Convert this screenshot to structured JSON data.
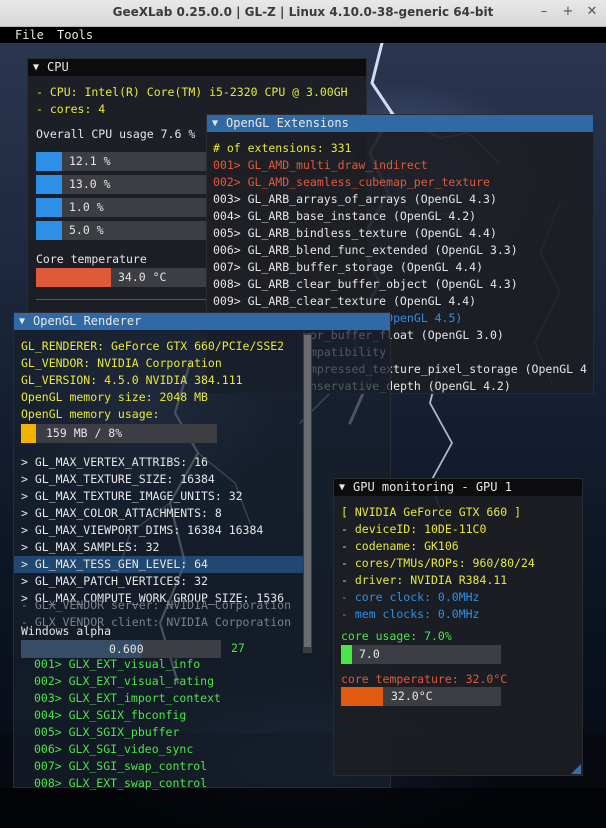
{
  "window": {
    "title": "GeeXLab 0.25.0.0 | GL-Z | Linux 4.10.0-38-generic 64-bit",
    "minimize": "–",
    "maximize": "+",
    "close": "✕"
  },
  "menu": [
    "File",
    "Tools"
  ],
  "cpu": {
    "title": "CPU",
    "name_line": "- CPU: Intel(R) Core(TM) i5-2320 CPU @ 3.00GH",
    "cores_line": "- cores: 4",
    "usage_label": "Overall CPU usage 7.6 %",
    "core_bars": [
      {
        "label": "12.1 %",
        "value": 12.1
      },
      {
        "label": "13.0 %",
        "value": 13.0
      },
      {
        "label": "1.0 %",
        "value": 1.0
      },
      {
        "label": "5.0 %",
        "value": 5.0
      }
    ],
    "temp_label": "Core temperature",
    "temp_value": "34.0 °C",
    "temp_fraction": 0.34,
    "colors": {
      "bar_fill": "#2e8fe6",
      "temp_fill": "#e05a3a"
    }
  },
  "extensions": {
    "title": "OpenGL Extensions",
    "count_line": "# of extensions: 331",
    "items": [
      {
        "text": "001> GL_AMD_multi_draw_indirect",
        "style": "r"
      },
      {
        "text": "002> GL_AMD_seamless_cubemap_per_texture",
        "style": "r"
      },
      {
        "text": "003> GL_ARB_arrays_of_arrays (OpenGL 4.3)",
        "style": "w"
      },
      {
        "text": "004> GL_ARB_base_instance (OpenGL 4.2)",
        "style": "w"
      },
      {
        "text": "005> GL_ARB_bindless_texture (OpenGL 4.4)",
        "style": "w"
      },
      {
        "text": "006> GL_ARB_blend_func_extended (OpenGL 3.3)",
        "style": "w"
      },
      {
        "text": "007> GL_ARB_buffer_storage (OpenGL 4.4)",
        "style": "w"
      },
      {
        "text": "008> GL_ARB_clear_buffer_object (OpenGL 4.3)",
        "style": "w"
      },
      {
        "text": "009> GL_ARB_clear_texture (OpenGL 4.4)",
        "style": "w"
      },
      {
        "text": "p_control (OpenGL 4.5)",
        "style": "bl"
      },
      {
        "text": "or_buffer_float (OpenGL 3.0)",
        "style": "w"
      },
      {
        "text": "mpatibility",
        "style": "w"
      },
      {
        "text": "mpressed_texture_pixel_storage (OpenGL 4",
        "style": "w"
      },
      {
        "text": "nservative_depth (OpenGL 4.2)",
        "style": "w"
      }
    ]
  },
  "renderer": {
    "title": "OpenGL Renderer",
    "lines": [
      {
        "text": "GL_RENDERER: GeForce GTX 660/PCIe/SSE2",
        "style": "y"
      },
      {
        "text": "GL_VENDOR: NVIDIA Corporation",
        "style": "y"
      },
      {
        "text": "GL_VERSION: 4.5.0 NVIDIA 384.111",
        "style": "y"
      },
      {
        "text": "OpenGL memory size: 2048 MB",
        "style": "y"
      },
      {
        "text": "OpenGL memory usage:",
        "style": "y"
      }
    ],
    "memory_bar": {
      "label": "159 MB / 8%",
      "value": 8,
      "fill": "#f0b400"
    },
    "limits": [
      "> GL_MAX_VERTEX_ATTRIBS: 16",
      "> GL_MAX_TEXTURE_SIZE: 16384",
      "> GL_MAX_TEXTURE_IMAGE_UNITS: 32",
      "> GL_MAX_COLOR_ATTACHMENTS: 8",
      "> GL_MAX_VIEWPORT_DIMS: 16384 16384",
      "> GL_MAX_SAMPLES: 32",
      "> GL_MAX_TESS_GEN_LEVEL: 64",
      "> GL_MAX_PATCH_VERTICES: 32",
      "> GL_MAX_COMPUTE_WORK_GROUP_SIZE: 1536"
    ],
    "glx_lines": [
      "- GLX_VENDOR server: NVIDIA Corporation",
      "- GLX_VENDOR client: NVIDIA Corporation"
    ],
    "alpha_label": "Windows alpha",
    "alpha_value": "0.600",
    "alpha_fraction": 0.6,
    "partial_count": "27",
    "glx_extensions": [
      "001> GLX_EXT_visual_info",
      "002> GLX_EXT_visual_rating",
      "003> GLX_EXT_import_context",
      "004> GLX_SGIX_fbconfig",
      "005> GLX_SGIX_pbuffer",
      "006> GLX_SGI_video_sync",
      "007> GLX_SGI_swap_control",
      "008> GLX_EXT_swap_control"
    ]
  },
  "gpu": {
    "title": "GPU monitoring - GPU 1",
    "name_line": "[ NVIDIA GeForce GTX 660 ]",
    "info": [
      {
        "text": "- deviceID: 10DE-11C0",
        "style": "y"
      },
      {
        "text": "- codename: GK106",
        "style": "y"
      },
      {
        "text": "- cores/TMUs/ROPs: 960/80/24",
        "style": "y"
      },
      {
        "text": "- driver: NVIDIA R384.11",
        "style": "y"
      },
      {
        "text": "- core clock: 0.0MHz",
        "style": "bl"
      },
      {
        "text": "- mem clocks: 0.0MHz",
        "style": "bl"
      }
    ],
    "usage_label": "core usage: 7.0%",
    "usage_value": "7.0",
    "usage_fraction": 0.07,
    "temp_label": "core temperature: 32.0°C",
    "temp_value": "32.0°C",
    "temp_fraction": 0.32,
    "colors": {
      "usage_fill": "#48e648",
      "temp_fill": "#e05a10"
    }
  }
}
